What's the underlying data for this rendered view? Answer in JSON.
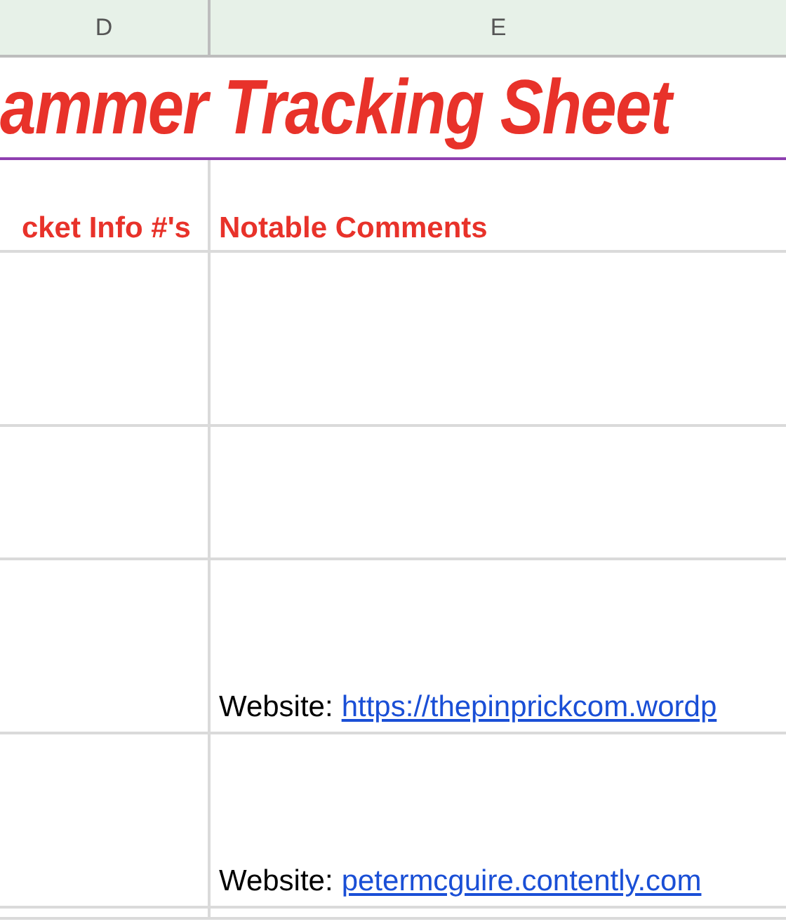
{
  "columns": [
    {
      "label": "D"
    },
    {
      "label": "E"
    }
  ],
  "title": "ammer Tracking Sheet",
  "header": [
    "cket Info #'s",
    "Notable Comments"
  ],
  "rows": [
    {
      "kind": "empty"
    },
    {
      "kind": "empty"
    },
    {
      "kind": "website",
      "label": "Website:",
      "link": "https://thepinprickcom.wordp"
    },
    {
      "kind": "website",
      "label": "Website:",
      "link": "petermcguire.contently.com"
    },
    {
      "kind": "empty"
    }
  ]
}
